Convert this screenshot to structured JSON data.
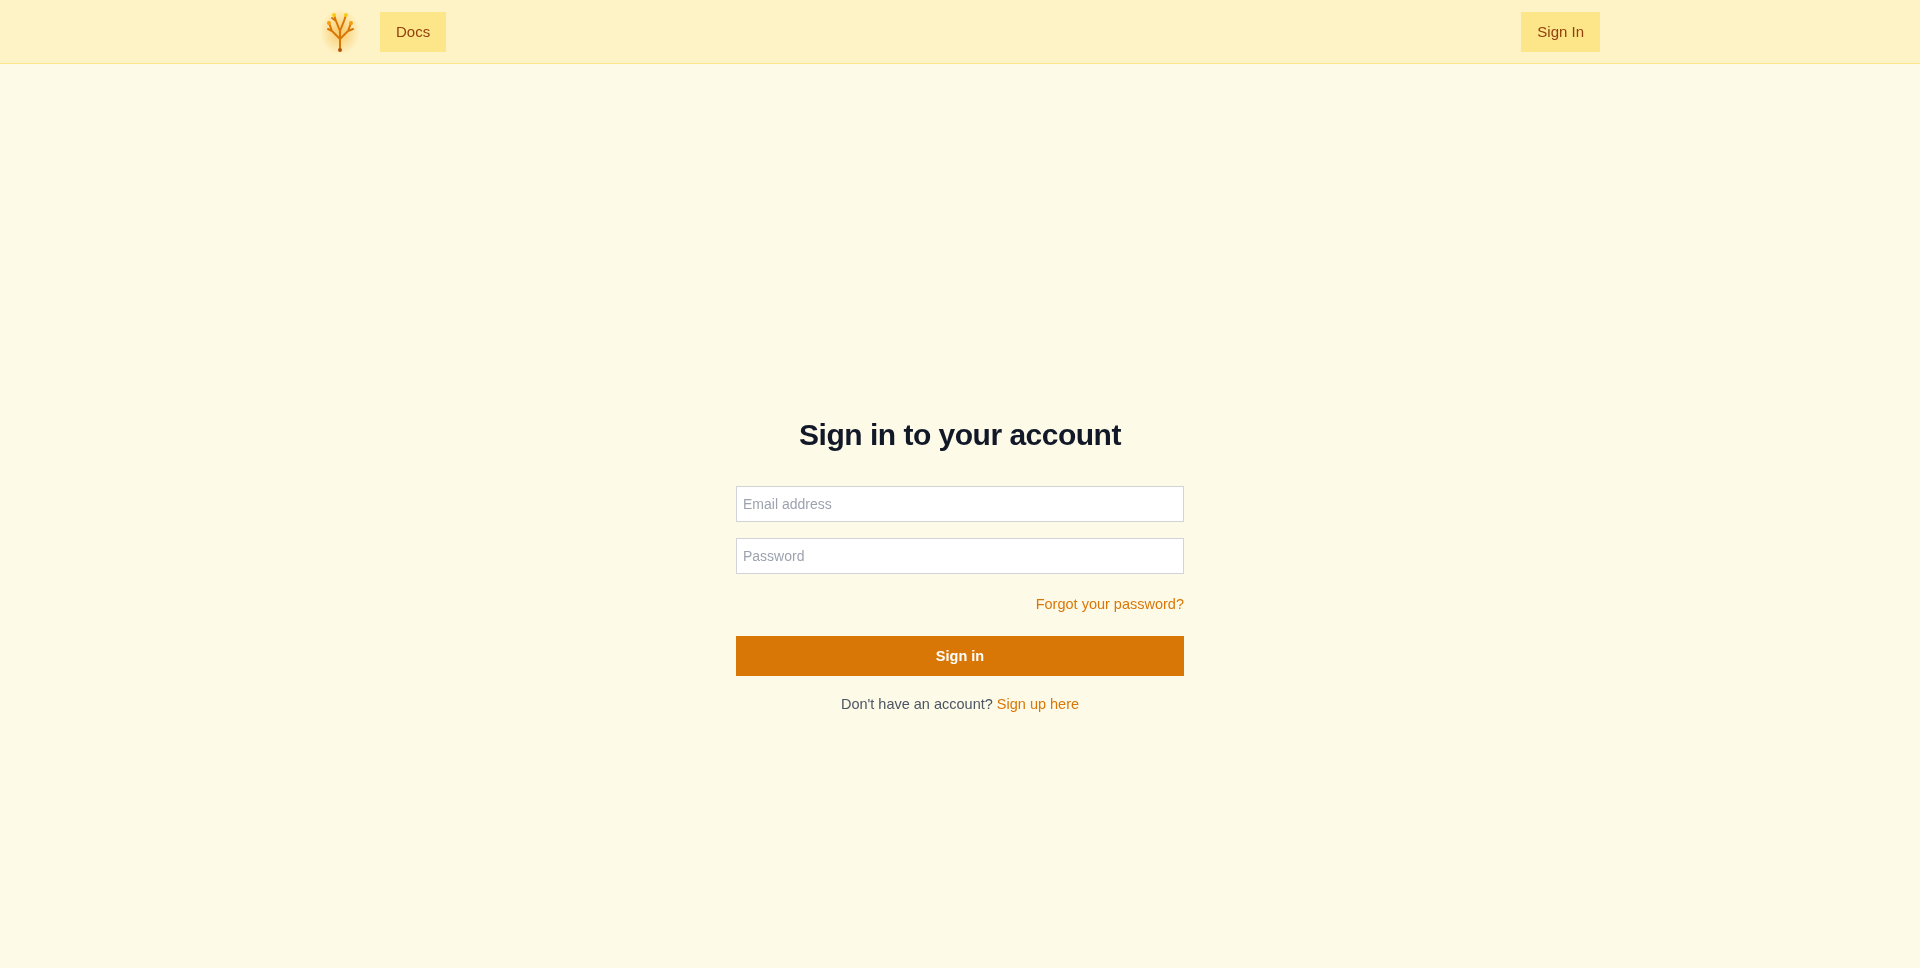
{
  "nav": {
    "links": [
      {
        "label": "Docs"
      }
    ],
    "sign_in": "Sign In"
  },
  "form": {
    "title": "Sign in to your account",
    "fields": [
      {
        "placeholder": "Email address"
      },
      {
        "placeholder": "Password"
      }
    ],
    "forgot": "Forgot your password?",
    "submit": "Sign in",
    "signup_prompt": "Don't have an account?",
    "signup_link": "Sign up here"
  }
}
